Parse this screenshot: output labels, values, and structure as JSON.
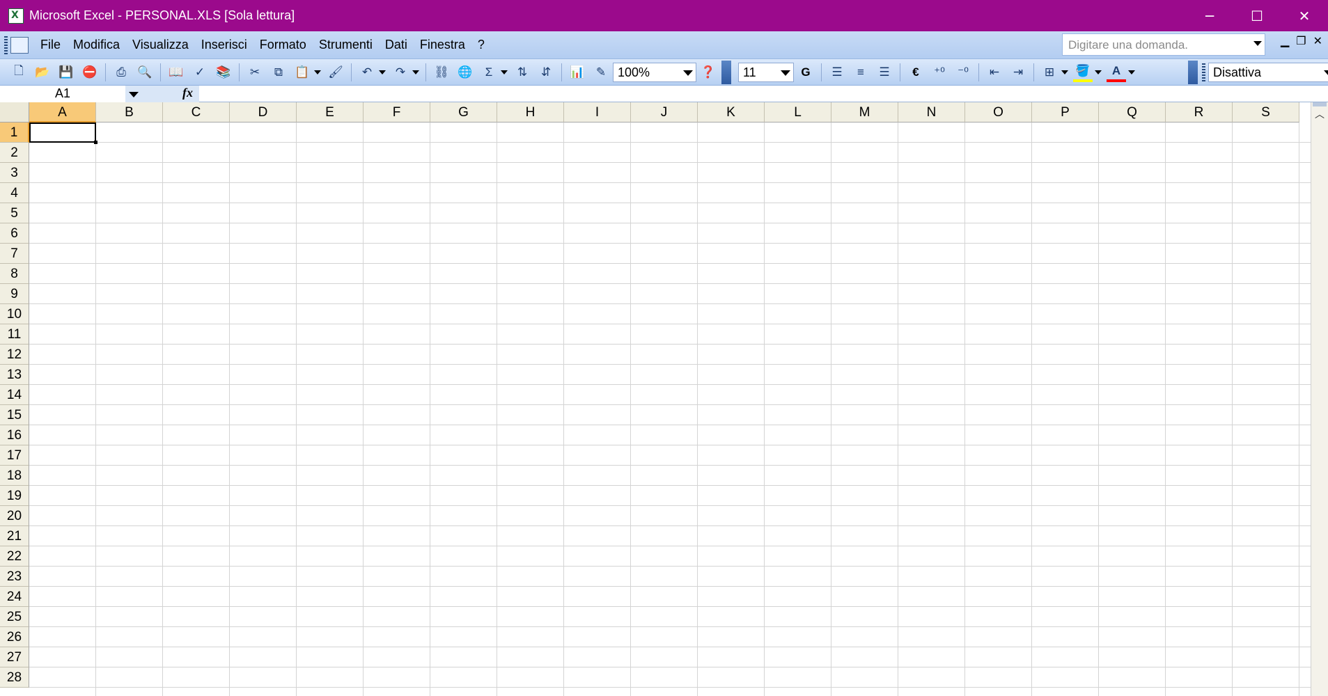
{
  "window": {
    "title": "Microsoft Excel - PERSONAL.XLS  [Sola lettura]",
    "minimize": "─",
    "maximize": "☐",
    "close": "✕"
  },
  "menu": {
    "items": [
      {
        "label": "File"
      },
      {
        "label": "Modifica"
      },
      {
        "label": "Visualizza"
      },
      {
        "label": "Inserisci"
      },
      {
        "label": "Formato"
      },
      {
        "label": "Strumenti"
      },
      {
        "label": "Dati"
      },
      {
        "label": "Finestra"
      },
      {
        "label": "?"
      }
    ],
    "ask_placeholder": "Digitare una domanda.",
    "mdi_min": "▁",
    "mdi_restore": "❐",
    "mdi_close": "✕"
  },
  "toolbar": {
    "zoom": "100%",
    "font_size": "11",
    "bold_label": "G",
    "sigma_label": "Σ",
    "euro_label": "€",
    "style_value": "Disattiva"
  },
  "formula_bar": {
    "name_box": "A1",
    "fx_label": "fx",
    "formula": ""
  },
  "sheet": {
    "columns": [
      "A",
      "B",
      "C",
      "D",
      "E",
      "F",
      "G",
      "H",
      "I",
      "J",
      "K",
      "L",
      "M",
      "N",
      "O",
      "P",
      "Q",
      "R",
      "S"
    ],
    "rows": [
      "1",
      "2",
      "3",
      "4",
      "5",
      "6",
      "7",
      "8",
      "9",
      "10",
      "11",
      "12",
      "13",
      "14",
      "15",
      "16",
      "17",
      "18",
      "19",
      "20",
      "21",
      "22",
      "23",
      "24",
      "25",
      "26",
      "27",
      "28"
    ],
    "active_cell": "A1"
  },
  "colors": {
    "title_bar": "#9b0a8c",
    "selected_header": "#f8c978"
  }
}
